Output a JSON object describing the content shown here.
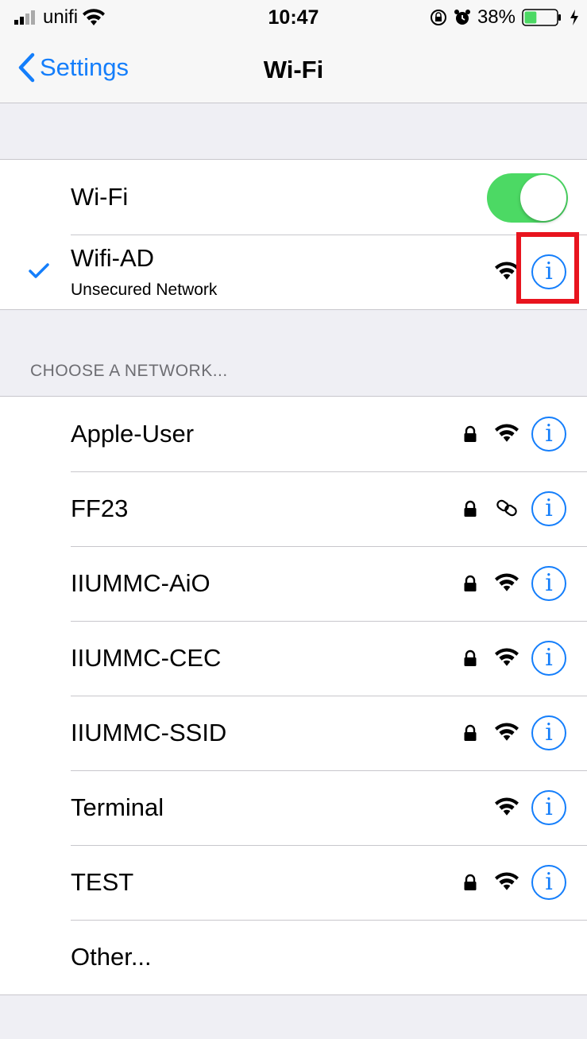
{
  "status_bar": {
    "carrier": "unifi",
    "time": "10:47",
    "battery_percent": "38%",
    "battery_level": 0.38
  },
  "nav": {
    "back_label": "Settings",
    "title": "Wi-Fi"
  },
  "wifi_toggle": {
    "label": "Wi-Fi",
    "on": true,
    "color": "#4cd964"
  },
  "connected_network": {
    "name": "Wifi-AD",
    "subtitle": "Unsecured Network"
  },
  "section_header": "CHOOSE A NETWORK...",
  "networks": [
    {
      "name": "Apple-User",
      "locked": true,
      "icon": "wifi-icon"
    },
    {
      "name": "FF23",
      "locked": true,
      "icon": "link-icon"
    },
    {
      "name": "IIUMMC-AiO",
      "locked": true,
      "icon": "wifi-icon"
    },
    {
      "name": "IIUMMC-CEC",
      "locked": true,
      "icon": "wifi-icon"
    },
    {
      "name": "IIUMMC-SSID",
      "locked": true,
      "icon": "wifi-icon"
    },
    {
      "name": "Terminal",
      "locked": false,
      "icon": "wifi-icon"
    },
    {
      "name": "TEST",
      "locked": true,
      "icon": "wifi-icon"
    }
  ],
  "other_label": "Other...",
  "info_glyph": "i",
  "colors": {
    "accent": "#147efb",
    "highlight": "#e8141e"
  }
}
